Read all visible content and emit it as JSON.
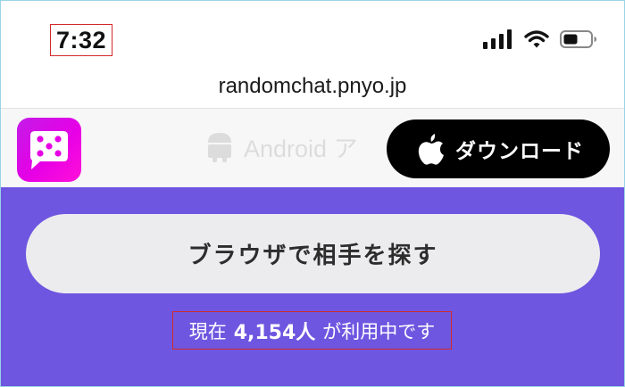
{
  "status_bar": {
    "time": "7:32",
    "icons": [
      "signal-icon",
      "wifi-icon",
      "battery-icon"
    ]
  },
  "url_bar": {
    "url": "randomchat.pnyo.jp"
  },
  "app_banner": {
    "app_icon": "dice-chat-icon",
    "android_label": "Android ア",
    "download_label": "ダウンロード",
    "download_icon": "apple-icon"
  },
  "main": {
    "browser_search_label": "ブラウザで相手を探す",
    "usage": {
      "prefix": "現在",
      "count": "4,154人",
      "suffix": "が利用中です"
    }
  },
  "colors": {
    "main_background": "#6e56e0",
    "app_icon_gradient": [
      "#c31ce8",
      "#ff10d8"
    ],
    "download_button": "#000000",
    "search_button": "#ececef",
    "highlight_border": "#d22a2a"
  }
}
